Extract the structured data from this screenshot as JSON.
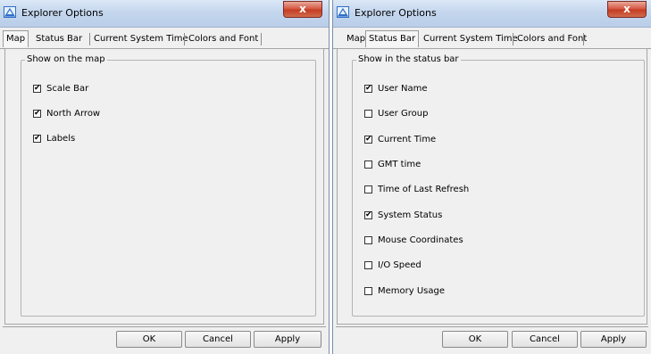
{
  "colors": {
    "title_gradient": "#c5d7ee",
    "close_button": "#c8432b",
    "dialog_bg": "#f0f0f0"
  },
  "window_left": {
    "title": "Explorer Options",
    "close_label": "x",
    "tabs": [
      {
        "label": "Map",
        "active": true
      },
      {
        "label": "Status Bar",
        "active": false
      },
      {
        "label": "Current System Time",
        "active": false
      },
      {
        "label": "Colors and Font",
        "active": false
      }
    ],
    "group_title": "Show on the map",
    "options": [
      {
        "label": "Scale Bar",
        "checked": true
      },
      {
        "label": "North Arrow",
        "checked": true
      },
      {
        "label": "Labels",
        "checked": true
      }
    ],
    "buttons": {
      "ok": "OK",
      "cancel": "Cancel",
      "apply": "Apply"
    }
  },
  "window_right": {
    "title": "Explorer Options",
    "close_label": "x",
    "tabs": [
      {
        "label": "Map",
        "active": false
      },
      {
        "label": "Status Bar",
        "active": true
      },
      {
        "label": "Current System Time",
        "active": false
      },
      {
        "label": "Colors and Font",
        "active": false
      }
    ],
    "group_title": "Show in the status bar",
    "options": [
      {
        "label": "User Name",
        "checked": true
      },
      {
        "label": "User Group",
        "checked": false
      },
      {
        "label": "Current Time",
        "checked": true
      },
      {
        "label": "GMT time",
        "checked": false
      },
      {
        "label": "Time of Last Refresh",
        "checked": false
      },
      {
        "label": "System Status",
        "checked": true
      },
      {
        "label": "Mouse Coordinates",
        "checked": false
      },
      {
        "label": "I/O Speed",
        "checked": false
      },
      {
        "label": "Memory Usage",
        "checked": false
      }
    ],
    "buttons": {
      "ok": "OK",
      "cancel": "Cancel",
      "apply": "Apply"
    }
  }
}
